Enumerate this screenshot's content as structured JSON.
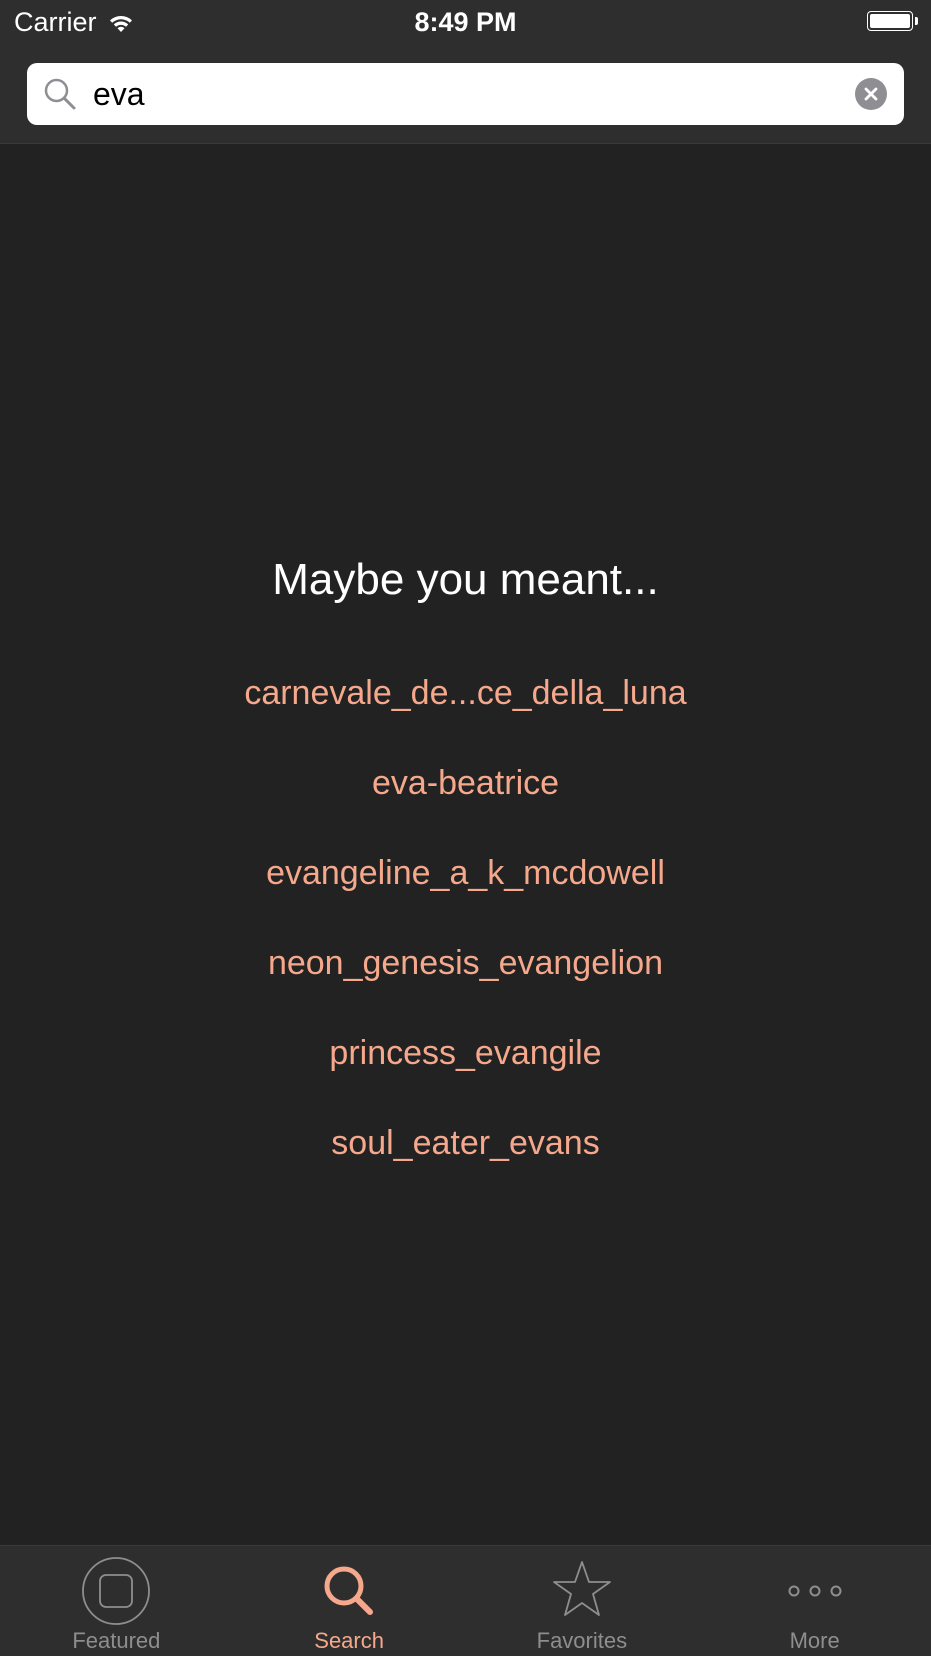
{
  "status_bar": {
    "carrier": "Carrier",
    "time": "8:49 PM"
  },
  "search": {
    "value": "eva",
    "placeholder": "Search"
  },
  "suggestions": {
    "title": "Maybe you meant...",
    "items": [
      "carnevale_de...ce_della_luna",
      "eva-beatrice",
      "evangeline_a_k_mcdowell",
      "neon_genesis_evangelion",
      "princess_evangile",
      "soul_eater_evans"
    ]
  },
  "tabbar": {
    "tabs": [
      {
        "label": "Featured",
        "icon": "featured-icon",
        "active": false
      },
      {
        "label": "Search",
        "icon": "search-icon",
        "active": true
      },
      {
        "label": "Favorites",
        "icon": "star-icon",
        "active": false
      },
      {
        "label": "More",
        "icon": "more-icon",
        "active": false
      }
    ]
  },
  "colors": {
    "background": "#222222",
    "bar": "#2e2e2e",
    "accent": "#f5a88c",
    "inactive": "#8e8e8e"
  }
}
